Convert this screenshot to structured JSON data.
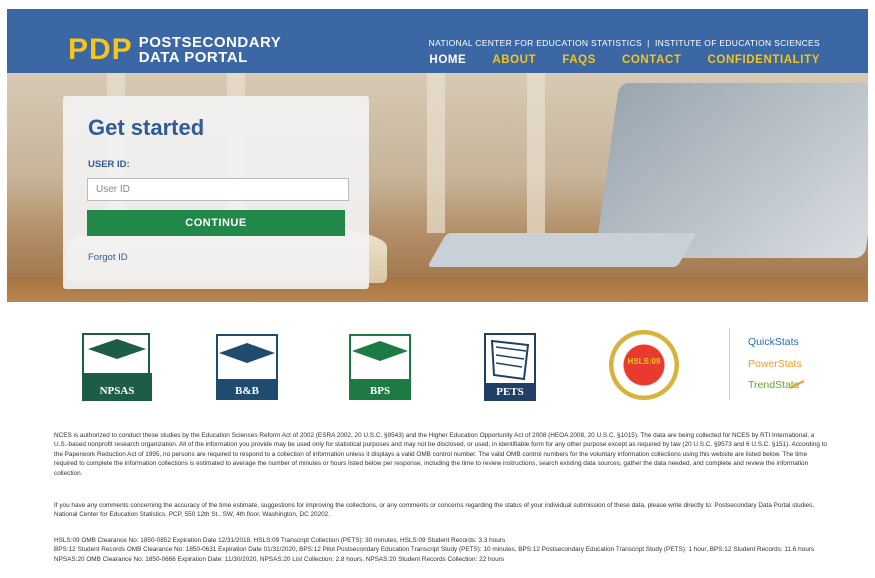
{
  "header": {
    "logo_mark": "PDP",
    "logo_line1": "POSTSECONDARY",
    "logo_line2": "DATA PORTAL",
    "agency": "NATIONAL CENTER FOR EDUCATION STATISTICS  |  INSTITUTE OF EDUCATION SCIENCES",
    "nav": [
      "HOME",
      "ABOUT",
      "FAQS",
      "CONTACT",
      "CONFIDENTIALITY"
    ]
  },
  "login": {
    "title": "Get started",
    "userid_label": "USER ID:",
    "userid_placeholder": "User ID",
    "userid_value": "",
    "continue_label": "CONTINUE",
    "forgot_label": "Forgot ID"
  },
  "studies": [
    "NPSAS",
    "B&B",
    "BPS",
    "PETS",
    "HSLS:09"
  ],
  "tools": [
    "QuickStats",
    "PowerStats",
    "TrendStats"
  ],
  "colors": {
    "header": "#3b67a5",
    "accent": "#f5c518",
    "button": "#22884a",
    "title": "#2f5b99"
  },
  "disclaimer": {
    "p1": "NCES is authorized to conduct these studies by the Education Sciences Reform Act of 2002 (ESRA 2002, 20 U.S.C. §9543) and the Higher Education Opportunity Act of 2008 (HEOA 2008, 20 U.S.C. §1015). The data are being collected for NCES by RTI International, a U.S.-based nonprofit research organization. All of the information you provide may be used only for statistical purposes and may not be disclosed, or used, in identifiable form for any other purpose except as required by law (20 U.S.C. §9573 and 6 U.S.C. §151). According to the Paperwork Reduction Act of 1995, no persons are required to respond to a collection of information unless it displays a valid OMB control number. The valid OMB control numbers for the voluntary information collections using this website are listed below. The time required to complete the information collections is estimated to average the number of minutes or hours listed below per response, including the time to review instructions, search existing data sources, gather the data needed, and complete and review the information collection.",
    "p2": "If you have any comments concerning the accuracy of the time estimate, suggestions for improving the collections, or any comments or concerns regarding the status of your individual submission of these data, please write directly to: Postsecondary Data Portal studies, National Center for Education Statistics, PCP, 550 12th St., SW, 4th floor, Washington, DC 20202.",
    "p3": "HSLS:09 OMB Clearance No: 1850-0852 Expiration Date 12/31/2018, HSLS:09 Transcript Collection (PETS): 30 minutes, HSLS:09 Student Records: 3.3 hours",
    "p4": "BPS:12 Student Records OMB Clearance No: 1850-0631 Expiration Date 01/31/2020, BPS:12 Pilot Postsecondary Education Transcript Study (PETS): 10 minutes, BPS:12 Postsecondary Education Transcript Study (PETS): 1 hour, BPS:12 Student Records: 11.6 hours",
    "p5": "NPSAS:20 OMB Clearance No: 1850-0666 Expiration Date: 11/30/2020, NPSAS:20 List Collection: 2.8 hours, NPSAS:20 Student Records Collection: 22 hours"
  }
}
